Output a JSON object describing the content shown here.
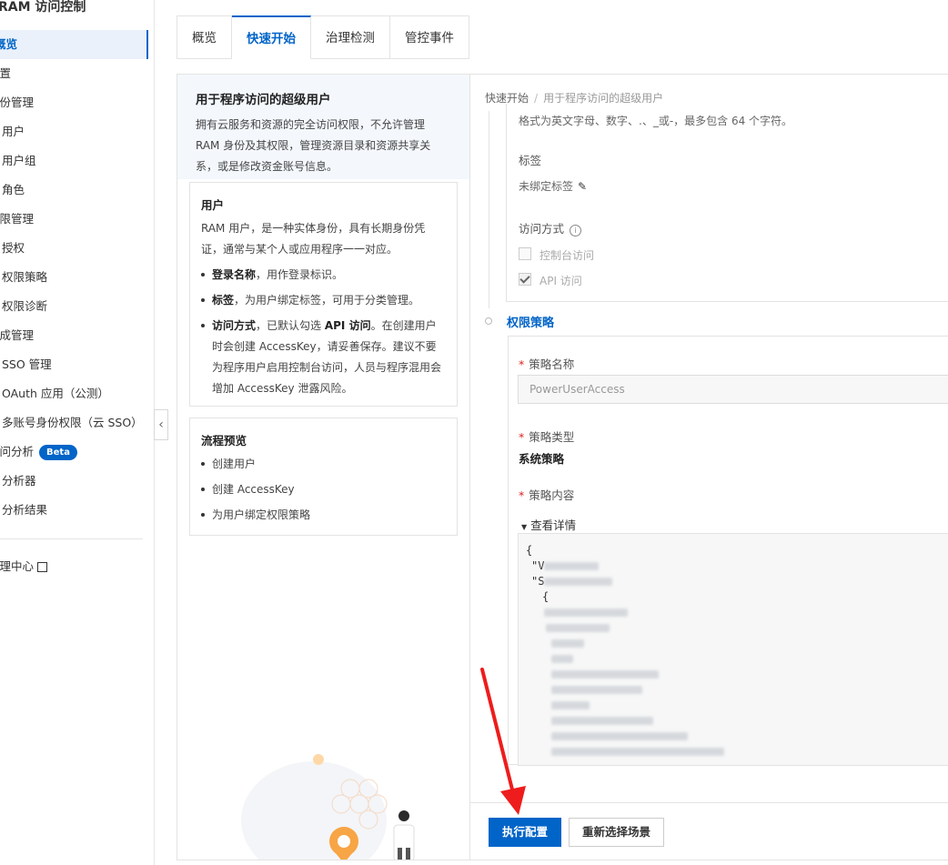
{
  "sidebar": {
    "title": "RAM 访问控制",
    "items": [
      {
        "label": "概览",
        "active": true
      },
      {
        "label": "设置"
      },
      {
        "label": "身份管理"
      },
      {
        "label": "用户"
      },
      {
        "label": "用户组"
      },
      {
        "label": "角色"
      },
      {
        "label": "权限管理"
      },
      {
        "label": "授权"
      },
      {
        "label": "权限策略"
      },
      {
        "label": "权限诊断"
      },
      {
        "label": "集成管理"
      },
      {
        "label": "SSO 管理"
      },
      {
        "label": "OAuth 应用（公测）"
      },
      {
        "label": "多账号身份权限（云 SSO）"
      },
      {
        "label": "访问分析"
      },
      {
        "label": "分析器"
      },
      {
        "label": "分析结果"
      }
    ],
    "beta_label": "Beta",
    "bottom_link": "治理中心"
  },
  "tabs": [
    "概览",
    "快速开始",
    "治理检测",
    "管控事件"
  ],
  "left_panel": {
    "intro_title": "用于程序访问的超级用户",
    "intro_text": "拥有云服务和资源的完全访问权限，不允许管理 RAM 身份及其权限，管理资源目录和资源共享关系，或是修改资金账号信息。",
    "user_card": {
      "title": "用户",
      "desc": "RAM 用户，是一种实体身份，具有长期身份凭证，通常与某个人或应用程序一一对应。",
      "bullets": [
        {
          "bold": "登录名称",
          "text": "，用作登录标识。"
        },
        {
          "bold": "标签",
          "text": "，为用户绑定标签，可用于分类管理。"
        },
        {
          "bold": "访问方式",
          "text": "，已默认勾选 ",
          "bold2": "API 访问",
          "text2": "。在创建用户时会创建 AccessKey，请妥善保存。建议不要为程序用户启用控制台访问，人员与程序混用会增加 AccessKey 泄露风险。"
        }
      ]
    },
    "flow_card": {
      "title": "流程预览",
      "steps": [
        "创建用户",
        "创建 AccessKey",
        "为用户绑定权限策略"
      ]
    }
  },
  "right_panel": {
    "breadcrumb": {
      "root": "快速开始",
      "current": "用于程序访问的超级用户"
    },
    "name_hint": "格式为英文字母、数字、.、_或-，最多包含 64 个字符。",
    "tag_label": "标签",
    "tag_value": "未绑定标签",
    "access_label": "访问方式",
    "access_options": [
      {
        "label": "控制台访问",
        "checked": false
      },
      {
        "label": "API 访问",
        "checked": true
      }
    ],
    "policy_step_title": "权限策略",
    "policy_name_label": "策略名称",
    "policy_name_value": "PowerUserAccess",
    "policy_type_label": "策略类型",
    "policy_type_value": "系统策略",
    "policy_content_label": "策略内容",
    "view_details": "查看详情",
    "code_lines": [
      "{",
      "\"V",
      "\"S",
      "{"
    ],
    "buttons": {
      "execute": "执行配置",
      "reselect": "重新选择场景"
    }
  }
}
